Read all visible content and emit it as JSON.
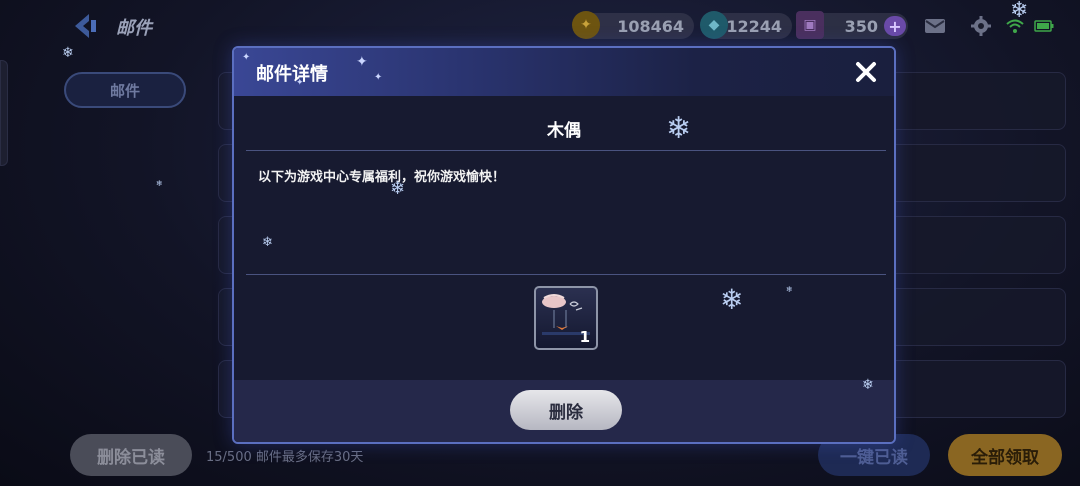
{
  "topbar": {
    "title": "邮件",
    "currencies": [
      {
        "icon": "gold-coin-icon",
        "value": "108464"
      },
      {
        "icon": "diamond-gem-icon",
        "value": "12244"
      },
      {
        "icon": "ticket-icon",
        "value": "350"
      }
    ],
    "add_symbol": "+",
    "icons": [
      "mail-icon",
      "settings-gear-icon",
      "wifi-icon",
      "battery-icon"
    ]
  },
  "sidebar": {
    "tab_label": "邮件"
  },
  "footer": {
    "delete_read_label": "删除已读",
    "note": "15/500 邮件最多保存30天",
    "read_all_label": "一键已读",
    "claim_all_label": "全部领取"
  },
  "modal": {
    "title": "邮件详情",
    "sender": "木偶",
    "body": "以下为游戏中心专属福利，祝你游戏愉快！",
    "attachment": {
      "icon": "item-thumbnail-icon",
      "count": "1"
    },
    "delete_label": "删除"
  },
  "colors": {
    "accent_blue": "#5b6fc0",
    "claim_gold": "#c89630"
  }
}
